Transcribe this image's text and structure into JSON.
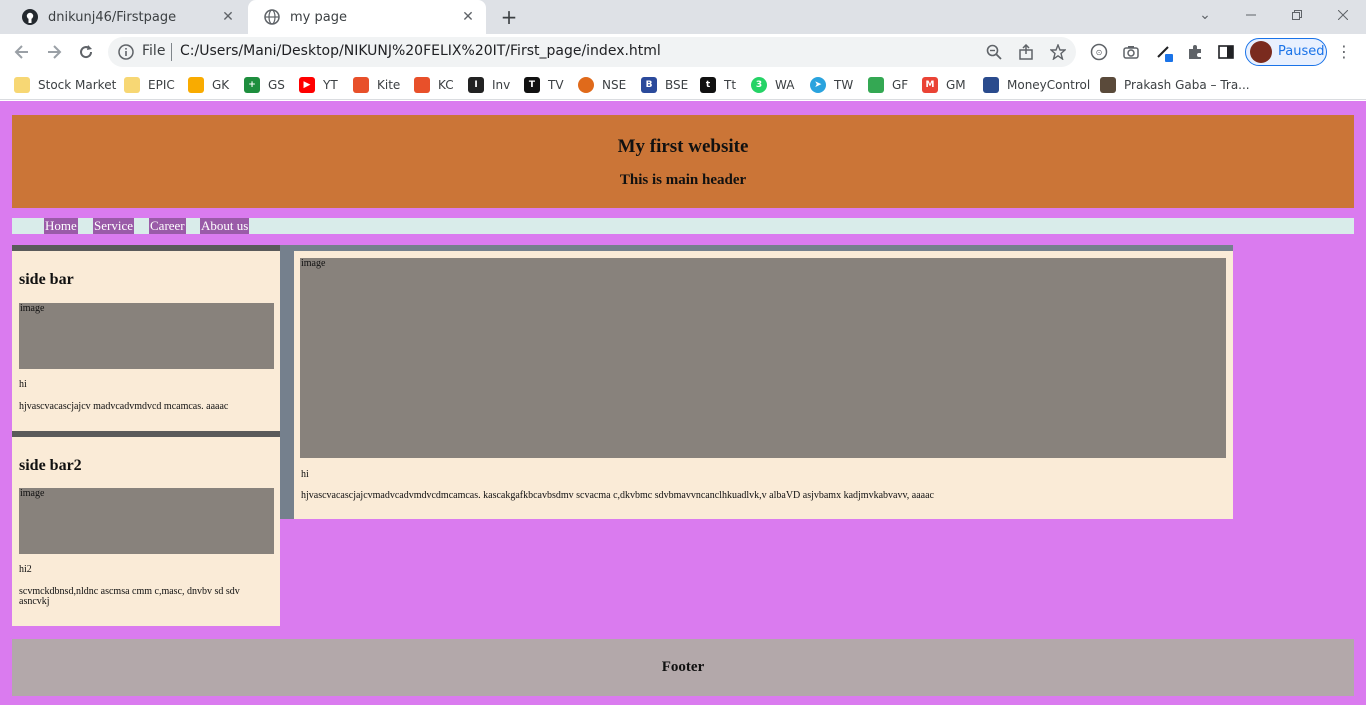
{
  "browser": {
    "tabs": [
      {
        "title": "dnikunj46/Firstpage",
        "icon": "github-icon",
        "active": false
      },
      {
        "title": "my page",
        "icon": "globe-icon",
        "active": true
      }
    ],
    "address": {
      "scheme_label": "File",
      "url": "C:/Users/Mani/Desktop/NIKUNJ%20FELIX%20IT/First_page/index.html"
    },
    "profile_status": "Paused",
    "bookmarks": [
      {
        "label": "Stock Market",
        "icon": "folder-icon",
        "color": "#f7d774"
      },
      {
        "label": "EPIC",
        "icon": "folder-icon",
        "color": "#f7d774"
      },
      {
        "label": "GK",
        "icon": "keep-icon",
        "color": "#f9ab00"
      },
      {
        "label": "GS",
        "icon": "sheets-icon",
        "color": "#1e8e3e"
      },
      {
        "label": "YT",
        "icon": "youtube-icon",
        "color": "#ff0000"
      },
      {
        "label": "Kite",
        "icon": "kite-icon",
        "color": "#e8502a"
      },
      {
        "label": "KC",
        "icon": "kite-icon",
        "color": "#e8502a"
      },
      {
        "label": "Inv",
        "icon": "investing-icon",
        "color": "#222222"
      },
      {
        "label": "TV",
        "icon": "tradingview-icon",
        "color": "#111111"
      },
      {
        "label": "NSE",
        "icon": "nse-icon",
        "color": "#e06a1b"
      },
      {
        "label": "BSE",
        "icon": "bse-icon",
        "color": "#2b4a9b"
      },
      {
        "label": "Tt",
        "icon": "tickertape-icon",
        "color": "#111111"
      },
      {
        "label": "WA",
        "icon": "whatsapp-icon",
        "color": "#25d366"
      },
      {
        "label": "TW",
        "icon": "telegram-icon",
        "color": "#2aa3de"
      },
      {
        "label": "GF",
        "icon": "google-finance-icon",
        "color": "#34a853"
      },
      {
        "label": "GM",
        "icon": "gmail-icon",
        "color": "#ea4335"
      },
      {
        "label": "MoneyControl",
        "icon": "moneycontrol-icon",
        "color": "#2a4b8d"
      },
      {
        "label": "Prakash Gaba – Tra...",
        "icon": "avatar-icon",
        "color": "#5a4a3a"
      }
    ]
  },
  "page": {
    "background": "#da7bef",
    "header": {
      "title": "My first website",
      "subtitle": "This is main header",
      "color": "#cb7537"
    },
    "menu": [
      "Home",
      "Service",
      "Career",
      "About us"
    ],
    "sidebars": [
      {
        "title": "side bar",
        "image_label": "image",
        "heading_text": "hi",
        "body_text": "hjvascvacascjajcv madvcadvmdvcd mcamcas. aaaac"
      },
      {
        "title": "side bar2",
        "image_label": "image",
        "heading_text": "hi2",
        "body_text": "scvmckdbnsd,nldnc ascmsa cmm c,masc, dnvbv sd sdv asncvkj"
      }
    ],
    "main": {
      "image_label": "image",
      "heading_text": "hi",
      "body_text": "hjvascvacascjajcvmadvcadvmdvcdmcamcas. kascakgafkbcavbsdmv scvacma c,dkvbmc sdvbmavvncanclhkuadlvk,v albaVD asjvbamx kadjmvkabvavv, aaaac"
    },
    "footer": {
      "title": "Footer",
      "color": "#b3a8aa"
    }
  }
}
